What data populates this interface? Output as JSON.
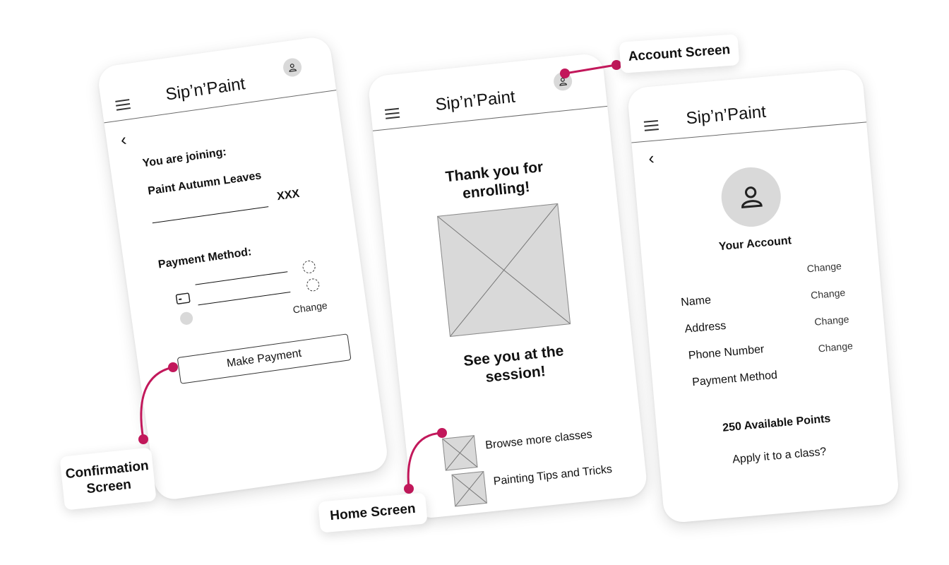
{
  "app_title": "Sip’n’Paint",
  "confirmation": {
    "joining_label": "You are joining:",
    "class_name": "Paint Autumn Leaves",
    "price": "XXX",
    "payment_label": "Payment Method:",
    "change_label": "Change",
    "button_label": "Make Payment"
  },
  "home": {
    "thanks": "Thank you for enrolling!",
    "see_you": "See you at the session!",
    "links": [
      "Browse more classes",
      "Painting Tips and Tricks"
    ]
  },
  "account": {
    "title": "Your Account",
    "fields": [
      {
        "label": "Name",
        "action": "Change"
      },
      {
        "label": "Address",
        "action": "Change"
      },
      {
        "label": "Phone Number",
        "action": "Change"
      },
      {
        "label": "Payment Method",
        "action": "Change"
      }
    ],
    "points": "250 Available Points",
    "apply": "Apply it to a class?"
  },
  "callouts": {
    "confirmation": "Confirmation Screen",
    "home": "Home Screen",
    "account": "Account Screen"
  },
  "colors": {
    "accent": "#c2185b",
    "placeholder": "#d9d9d9"
  },
  "icons": [
    "menu-icon",
    "user-icon",
    "back-arrow-icon",
    "credit-card-icon",
    "image-placeholder-icon"
  ]
}
